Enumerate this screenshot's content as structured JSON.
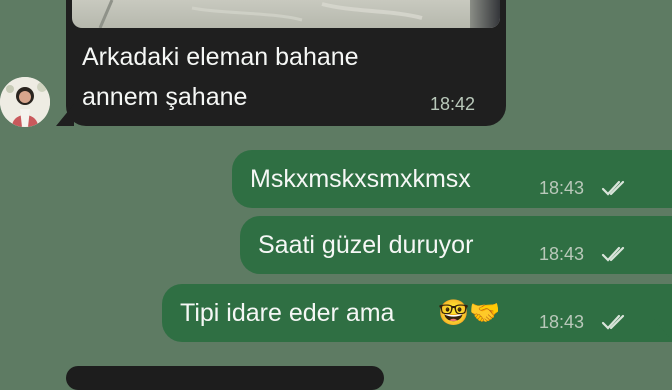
{
  "conversation": {
    "incoming": {
      "text_line1": "Arkadaki eleman bahane",
      "text_line2": "annem şahane",
      "time": "18:42"
    },
    "outgoing": [
      {
        "text": "Mskxmskxsmxkmsx",
        "time": "18:43"
      },
      {
        "text": "Saati güzel duruyor",
        "time": "18:43"
      },
      {
        "text": "Tipi idare eder ama",
        "emoji": "🤓🤝",
        "time": "18:43"
      }
    ]
  },
  "colors": {
    "chat_background": "#5e7b63",
    "incoming_bubble": "#1f1f1f",
    "outgoing_bubble": "#2f6f43",
    "timestamp": "#b9c8ba"
  }
}
